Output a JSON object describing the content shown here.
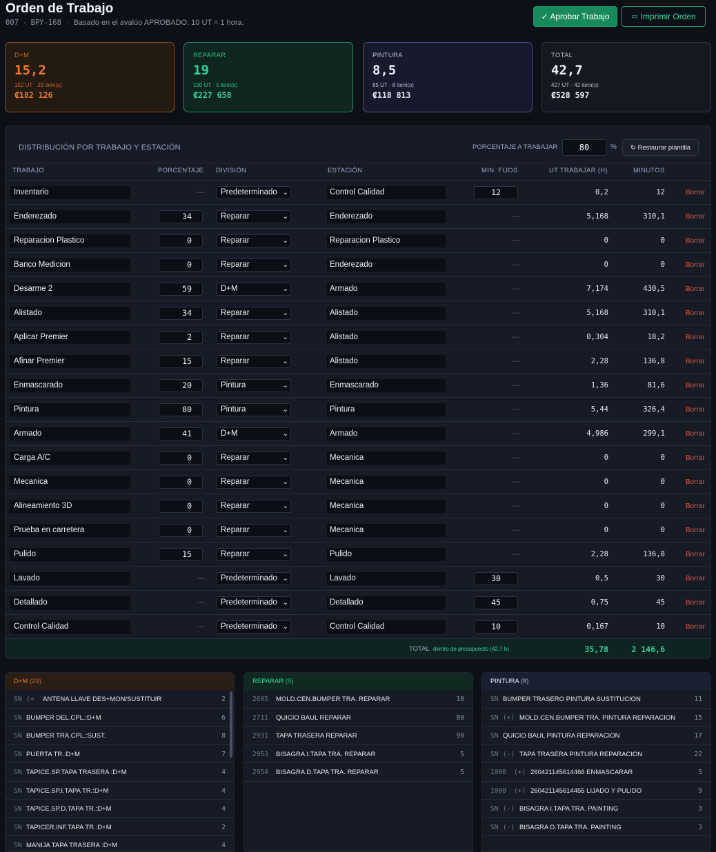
{
  "header": {
    "title": "Orden de Trabajo",
    "code": "007",
    "plate": "BPY-168",
    "basis": "Basado en el avalúo APROBADO. 10 UT = 1 hora.",
    "approve_label": "✓ Aprobar Trabajo",
    "print_label": "Imprimir Orden"
  },
  "cards": {
    "dm": {
      "label": "D+M",
      "value": "15,2",
      "meta": "152 UT · 29 item(s)",
      "money": "₡182 126"
    },
    "rep": {
      "label": "REPARAR",
      "value": "19",
      "meta": "190 UT · 5 item(s)",
      "money": "₡227 658"
    },
    "pin": {
      "label": "PINTURA",
      "value": "8,5",
      "meta": "85 UT · 8 item(s)",
      "money": "₡118 813"
    },
    "tot": {
      "label": "TOTAL",
      "value": "42,7",
      "meta": "427 UT · 42 item(s)",
      "money": "₡528 597"
    }
  },
  "distribution": {
    "title": "DISTRIBUCIÓN POR TRABAJO Y ESTACIÓN",
    "pct_label": "PORCENTAJE A TRABAJAR",
    "pct_value": "80",
    "pct_symbol": "%",
    "restore_label": "↻ Restaurar plantilla",
    "columns": {
      "trabajo": "TRABAJO",
      "porcentaje": "PORCENTAJE",
      "division": "DIVISIÓN",
      "estacion": "ESTACIÓN",
      "fijos": "MIN. FIJOS",
      "ut": "UT TRABAJAR (H)",
      "minutos": "MINUTOS"
    },
    "dash": "—",
    "delete_label": "Borrar",
    "rows": [
      {
        "job": "Inventario",
        "pct": "",
        "division": "Predeterminado",
        "station": "Control Calidad",
        "fixed": "12",
        "ut": "0,2",
        "min": "12"
      },
      {
        "job": "Enderezado",
        "pct": "34",
        "division": "Reparar",
        "station": "Enderezado",
        "fixed": "",
        "ut": "5,168",
        "min": "310,1"
      },
      {
        "job": "Reparacion Plastico",
        "pct": "0",
        "division": "Reparar",
        "station": "Reparacion Plastico",
        "fixed": "",
        "ut": "0",
        "min": "0"
      },
      {
        "job": "Banco Medicion",
        "pct": "0",
        "division": "Reparar",
        "station": "Enderezado",
        "fixed": "",
        "ut": "0",
        "min": "0"
      },
      {
        "job": "Desarme 2",
        "pct": "59",
        "division": "D+M",
        "station": "Armado",
        "fixed": "",
        "ut": "7,174",
        "min": "430,5"
      },
      {
        "job": "Alistado",
        "pct": "34",
        "division": "Reparar",
        "station": "Alistado",
        "fixed": "",
        "ut": "5,168",
        "min": "310,1"
      },
      {
        "job": "Aplicar Premier",
        "pct": "2",
        "division": "Reparar",
        "station": "Alistado",
        "fixed": "",
        "ut": "0,304",
        "min": "18,2"
      },
      {
        "job": "Afinar Premier",
        "pct": "15",
        "division": "Reparar",
        "station": "Alistado",
        "fixed": "",
        "ut": "2,28",
        "min": "136,8"
      },
      {
        "job": "Enmascarado",
        "pct": "20",
        "division": "Pintura",
        "station": "Enmascarado",
        "fixed": "",
        "ut": "1,36",
        "min": "81,6"
      },
      {
        "job": "Pintura",
        "pct": "80",
        "division": "Pintura",
        "station": "Pintura",
        "fixed": "",
        "ut": "5,44",
        "min": "326,4"
      },
      {
        "job": "Armado",
        "pct": "41",
        "division": "D+M",
        "station": "Armado",
        "fixed": "",
        "ut": "4,986",
        "min": "299,1"
      },
      {
        "job": "Carga A/C",
        "pct": "0",
        "division": "Reparar",
        "station": "Mecanica",
        "fixed": "",
        "ut": "0",
        "min": "0"
      },
      {
        "job": "Mecanica",
        "pct": "0",
        "division": "Reparar",
        "station": "Mecanica",
        "fixed": "",
        "ut": "0",
        "min": "0"
      },
      {
        "job": "Alineamiento 3D",
        "pct": "0",
        "division": "Reparar",
        "station": "Mecanica",
        "fixed": "",
        "ut": "0",
        "min": "0"
      },
      {
        "job": "Prueba en carretera",
        "pct": "0",
        "division": "Reparar",
        "station": "Mecanica",
        "fixed": "",
        "ut": "0",
        "min": "0"
      },
      {
        "job": "Pulido",
        "pct": "15",
        "division": "Reparar",
        "station": "Pulido",
        "fixed": "",
        "ut": "2,28",
        "min": "136,8"
      },
      {
        "job": "Lavado",
        "pct": "",
        "division": "Predeterminado",
        "station": "Lavado",
        "fixed": "30",
        "ut": "0,5",
        "min": "30"
      },
      {
        "job": "Detallado",
        "pct": "",
        "division": "Predeterminado",
        "station": "Detallado",
        "fixed": "45",
        "ut": "0,75",
        "min": "45"
      },
      {
        "job": "Control Calidad",
        "pct": "",
        "division": "Predeterminado",
        "station": "Control Calidad",
        "fixed": "10",
        "ut": "0,167",
        "min": "10"
      }
    ],
    "total": {
      "label": "TOTAL",
      "note": "dentro de presupuesto (42,7 h)",
      "ut": "35,78",
      "min": "2 146,6"
    }
  },
  "lists": {
    "dm": {
      "title": "D+M",
      "count": "(29)",
      "items": [
        {
          "code": "SN",
          "flag": "(+",
          "desc": "ANTENA LLAVE DES+MON/SUSTITUIR",
          "qty": "2"
        },
        {
          "code": "SN",
          "flag": "",
          "desc": "BUMPER DEL.CPL.:D+M",
          "qty": "6"
        },
        {
          "code": "SN",
          "flag": "",
          "desc": "BUMPER TRA.CPL.:SUST.",
          "qty": "8"
        },
        {
          "code": "SN",
          "flag": "",
          "desc": "PUERTA TR.:D+M",
          "qty": "7"
        },
        {
          "code": "SN",
          "flag": "",
          "desc": "TAPICE.SP.TAPA TRASERA :D+M",
          "qty": "4"
        },
        {
          "code": "SN",
          "flag": "",
          "desc": "TAPICE.SP.I.TAPA TR.:D+M",
          "qty": "4"
        },
        {
          "code": "SN",
          "flag": "",
          "desc": "TAPICE.SP.D.TAPA TR.:D+M",
          "qty": "4"
        },
        {
          "code": "SN",
          "flag": "",
          "desc": "TAPICER.INF.TAPA TR.:D+M",
          "qty": "2"
        },
        {
          "code": "SN",
          "flag": "",
          "desc": "MANIJA TAPA TRASERA :D+M",
          "qty": "4"
        }
      ]
    },
    "rep": {
      "title": "REPARAR",
      "count": "(5)",
      "items": [
        {
          "code": "2605",
          "flag": "",
          "desc": "MOLD.CEN.BUMPER TRA. REPARAR",
          "qty": "10"
        },
        {
          "code": "2711",
          "flag": "",
          "desc": "QUICIO BAUL REPARAR",
          "qty": "80"
        },
        {
          "code": "2931",
          "flag": "",
          "desc": "TAPA TRASERA REPARAR",
          "qty": "90"
        },
        {
          "code": "2953",
          "flag": "",
          "desc": "BISAGRA I.TAPA TRA. REPARAR",
          "qty": "5"
        },
        {
          "code": "2954",
          "flag": "",
          "desc": "BISAGRA D.TAPA TRA. REPARAR",
          "qty": "5"
        }
      ]
    },
    "pin": {
      "title": "PINTURA",
      "count": "(8)",
      "items": [
        {
          "code": "SN",
          "flag": "",
          "desc": "BUMPER TRASERO PINTURA SUSTITUCION",
          "qty": "11"
        },
        {
          "code": "SN",
          "flag": "(+)",
          "desc": "MOLD.CEN.BUMPER TRA. PINTURA REPARACION",
          "qty": "15"
        },
        {
          "code": "SN",
          "flag": "",
          "desc": "QUICIO BAUL PINTURA REPARACION",
          "qty": "17"
        },
        {
          "code": "SN",
          "flag": "(-)",
          "desc": "TAPA TRASERA PINTURA REPARACION",
          "qty": "22"
        },
        {
          "code": "1000",
          "flag": "(+)",
          "desc": "260421145614466 ENMASCARAR",
          "qty": "5"
        },
        {
          "code": "1000",
          "flag": "(+)",
          "desc": "260421145614455 LIJADO Y PULIDO",
          "qty": "9"
        },
        {
          "code": "SN",
          "flag": "(-)",
          "desc": "BISAGRA I.TAPA TRA. PAINTING",
          "qty": "3"
        },
        {
          "code": "SN",
          "flag": "(-)",
          "desc": "BISAGRA D.TAPA TRA. PAINTING",
          "qty": "3"
        }
      ]
    }
  }
}
